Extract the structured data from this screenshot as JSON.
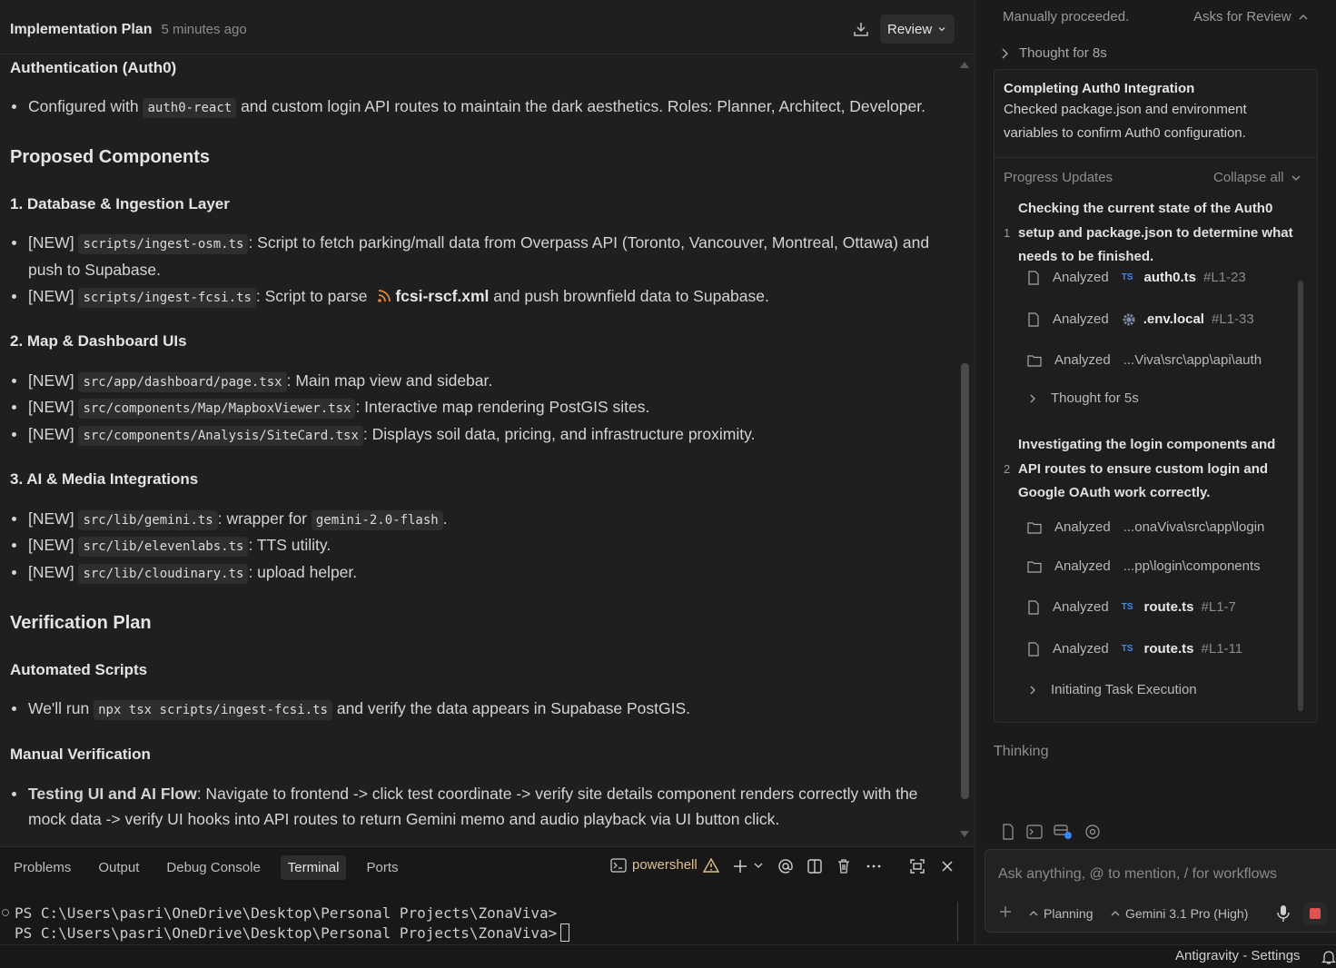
{
  "editor": {
    "title": "Implementation Plan",
    "timestamp": "5 minutes ago",
    "review_label": "Review",
    "sections": {
      "auth_heading": "Authentication (Auth0)",
      "auth_bullet": {
        "pre": "Configured with",
        "code": "auth0-react",
        "post": "and custom login API routes to maintain the dark aesthetics. Roles: Planner, Architect, Developer."
      },
      "proposed_heading": "Proposed Components",
      "db_heading": "1. Database & Ingestion Layer",
      "db_items": [
        {
          "tag": "[NEW]",
          "code": "scripts/ingest-osm.ts",
          "text": ": Script to fetch parking/mall data from Overpass API (Toronto, Vancouver, Montreal, Ottawa) and push to Supabase."
        },
        {
          "tag": "[NEW]",
          "code": "scripts/ingest-fcsi.ts",
          "text": ": Script to parse",
          "file": "fcsi-rscf.xml",
          "post": "and push brownfield data to Supabase."
        }
      ],
      "map_heading": "2. Map & Dashboard UIs",
      "map_items": [
        {
          "tag": "[NEW]",
          "code": "src/app/dashboard/page.tsx",
          "text": ": Main map view and sidebar."
        },
        {
          "tag": "[NEW]",
          "code": "src/components/Map/MapboxViewer.tsx",
          "text": ": Interactive map rendering PostGIS sites."
        },
        {
          "tag": "[NEW]",
          "code": "src/components/Analysis/SiteCard.tsx",
          "text": ": Displays soil data, pricing, and infrastructure proximity."
        }
      ],
      "ai_heading": "3. AI & Media Integrations",
      "ai_items": [
        {
          "tag": "[NEW]",
          "code": "src/lib/gemini.ts",
          "text": ": wrapper for",
          "code2": "gemini-2.0-flash",
          "post": "."
        },
        {
          "tag": "[NEW]",
          "code": "src/lib/elevenlabs.ts",
          "text": ": TTS utility."
        },
        {
          "tag": "[NEW]",
          "code": "src/lib/cloudinary.ts",
          "text": ": upload helper."
        }
      ],
      "verification_heading": "Verification Plan",
      "automated_heading": "Automated Scripts",
      "automated_bullet": {
        "pre": "We'll run",
        "code": "npx tsx scripts/ingest-fcsi.ts",
        "post": "and verify the data appears in Supabase PostGIS."
      },
      "manual_heading": "Manual Verification",
      "manual_bullet": {
        "bold": "Testing UI and AI Flow",
        "text": ": Navigate to frontend -> click test coordinate -> verify site details component renders correctly with the mock data -> verify UI hooks into API routes to return Gemini memo and audio playback via UI button click."
      }
    }
  },
  "panel": {
    "tabs": [
      "Problems",
      "Output",
      "Debug Console",
      "Terminal",
      "Ports"
    ],
    "active_tab": "Terminal",
    "shell": "powershell",
    "terminal_lines": [
      "PS C:\\Users\\pasri\\OneDrive\\Desktop\\Personal Projects\\ZonaViva>",
      "PS C:\\Users\\pasri\\OneDrive\\Desktop\\Personal Projects\\ZonaViva>"
    ]
  },
  "statusbar": {
    "settings_label": "Antigravity - Settings"
  },
  "agent": {
    "manual_status": "Manually proceeded.",
    "asks_for_review": "Asks for Review",
    "thought_top": "Thought for 8s",
    "card_title": "Completing Auth0 Integration",
    "card_desc": "Checked package.json and environment variables to confirm Auth0 configuration.",
    "progress_label": "Progress Updates",
    "collapse_label": "Collapse all",
    "steps": [
      {
        "num": "1",
        "title": "Checking the current state of the Auth0 setup and package.json to determine what needs to be finished.",
        "rows": [
          {
            "icon": "file-icon",
            "verb": "Analyzed",
            "badge": "TS",
            "name": "auth0.ts",
            "range": "#L1-23"
          },
          {
            "icon": "file-icon",
            "verb": "Analyzed",
            "badge": "gear",
            "name": ".env.local",
            "range": "#L1-33"
          },
          {
            "icon": "folder-icon",
            "verb": "Analyzed",
            "badge": "",
            "name": "...Viva\\src\\app\\api\\auth",
            "range": ""
          },
          {
            "icon": "chevron",
            "verb": "Thought for 5s",
            "badge": "",
            "name": "",
            "range": ""
          }
        ]
      },
      {
        "num": "2",
        "title": "Investigating the login components and API routes to ensure custom login and Google OAuth work correctly.",
        "rows": [
          {
            "icon": "folder-icon",
            "verb": "Analyzed",
            "badge": "",
            "name": "...onaViva\\src\\app\\login",
            "range": ""
          },
          {
            "icon": "folder-icon",
            "verb": "Analyzed",
            "badge": "",
            "name": "...pp\\login\\components",
            "range": ""
          },
          {
            "icon": "file-icon",
            "verb": "Analyzed",
            "badge": "TS",
            "name": "route.ts",
            "range": "#L1-7"
          },
          {
            "icon": "file-icon",
            "verb": "Analyzed",
            "badge": "TS",
            "name": "route.ts",
            "range": "#L1-11"
          },
          {
            "icon": "chevron",
            "verb": "Initiating Task Execution",
            "badge": "",
            "name": "",
            "range": ""
          }
        ]
      }
    ],
    "thinking": "Thinking",
    "input_placeholder": "Ask anything, @ to mention, / for workflows",
    "mode": "Planning",
    "model": "Gemini 3.1 Pro (High)"
  }
}
